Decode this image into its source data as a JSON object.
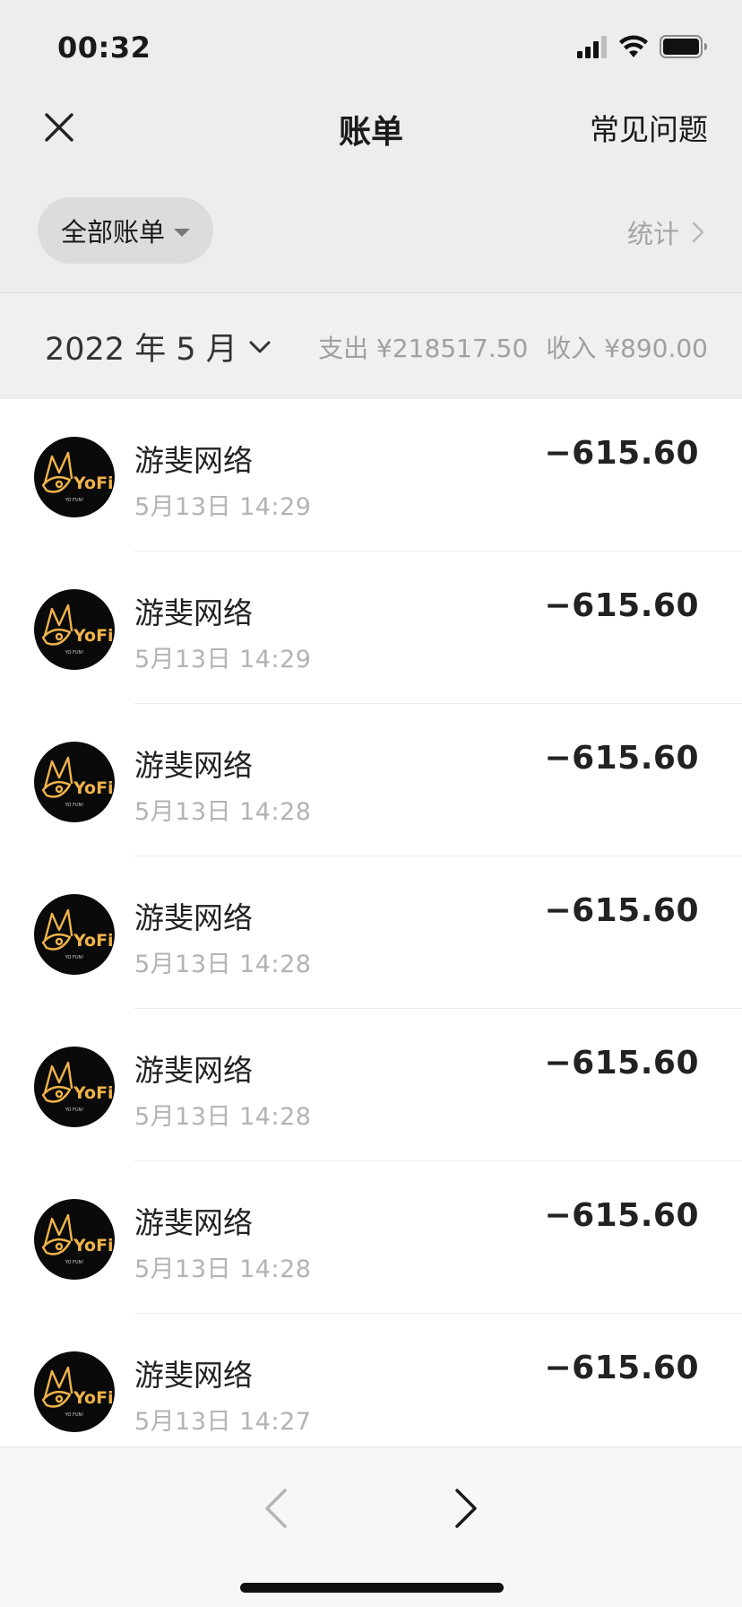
{
  "status": {
    "time": "00:32",
    "icons": [
      "signal-icon",
      "wifi-icon",
      "battery-icon"
    ]
  },
  "nav": {
    "close_icon": "close-icon",
    "title": "账单",
    "faq": "常见问题"
  },
  "filter": {
    "label": "全部账单",
    "stats": "统计"
  },
  "month": {
    "label": "2022 年 5 月",
    "expense": "支出 ¥218517.50",
    "income": "收入 ¥890.00"
  },
  "transactions": [
    {
      "merchant": "游斐网络",
      "time": "5月13日 14:29",
      "amount": "−615.60"
    },
    {
      "merchant": "游斐网络",
      "time": "5月13日 14:29",
      "amount": "−615.60"
    },
    {
      "merchant": "游斐网络",
      "time": "5月13日 14:28",
      "amount": "−615.60"
    },
    {
      "merchant": "游斐网络",
      "time": "5月13日 14:28",
      "amount": "−615.60"
    },
    {
      "merchant": "游斐网络",
      "time": "5月13日 14:28",
      "amount": "−615.60"
    },
    {
      "merchant": "游斐网络",
      "time": "5月13日 14:28",
      "amount": "−615.60"
    },
    {
      "merchant": "游斐网络",
      "time": "5月13日 14:27",
      "amount": "−615.60"
    }
  ],
  "logo": {
    "text": "YoFi",
    "tagline": "YO FUN!",
    "color": "#f0b44a"
  },
  "pagination": {
    "prev_icon": "chevron-left-icon",
    "next_icon": "chevron-right-icon"
  }
}
